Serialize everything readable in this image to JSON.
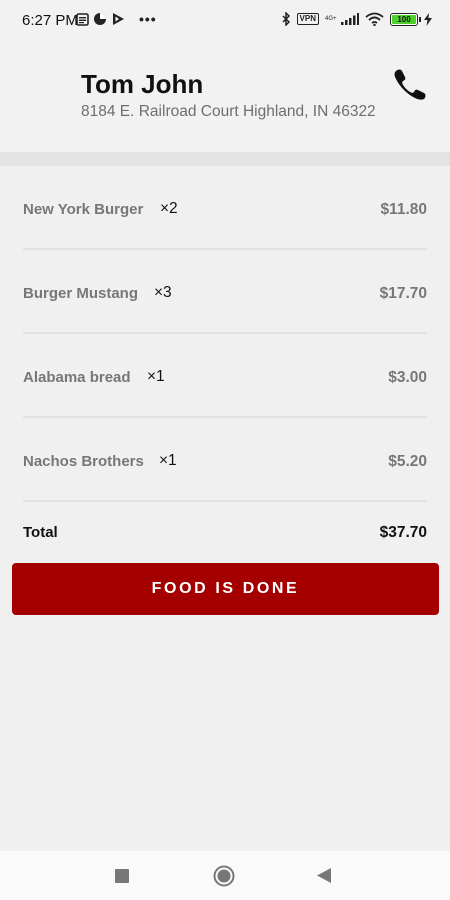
{
  "status_bar": {
    "time": "6:27 PM",
    "vpn_label": "VPN",
    "network_label": "4G+",
    "battery_level": "100",
    "battery_color": "#4cd12b"
  },
  "customer": {
    "name": "Tom John",
    "address": "8184 E. Railroad Court Highland, IN 46322",
    "call_icon": "phone-icon"
  },
  "order": {
    "items": [
      {
        "name": "New York Burger",
        "qty": "×2",
        "price": "$11.80"
      },
      {
        "name": "Burger Mustang",
        "qty": "×3",
        "price": "$17.70"
      },
      {
        "name": "Alabama bread",
        "qty": "×1",
        "price": "$3.00"
      },
      {
        "name": "Nachos Brothers",
        "qty": "×1",
        "price": "$5.20"
      }
    ],
    "total_label": "Total",
    "total_value": "$37.70"
  },
  "actions": {
    "done_label": "FOOD IS DONE",
    "done_color": "#a50000"
  },
  "nav": {
    "recents_icon": "square-icon",
    "home_icon": "circle-icon",
    "back_icon": "triangle-back-icon"
  }
}
